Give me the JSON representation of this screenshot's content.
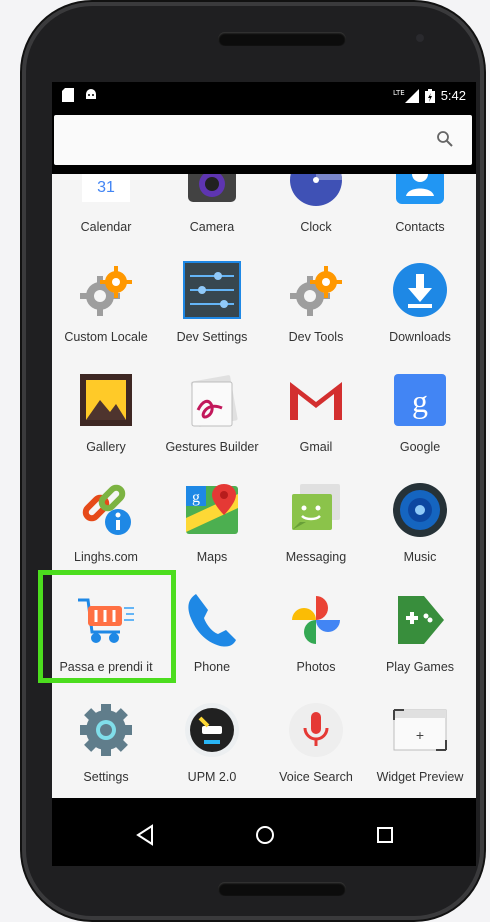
{
  "status": {
    "time": "5:42",
    "network": "LTE"
  },
  "apps": {
    "row1": [
      {
        "label": "Calendar",
        "icon": "calendar-icon"
      },
      {
        "label": "Camera",
        "icon": "camera-icon"
      },
      {
        "label": "Clock",
        "icon": "clock-icon"
      },
      {
        "label": "Contacts",
        "icon": "contacts-icon"
      }
    ],
    "row2": [
      {
        "label": "Custom Locale",
        "icon": "gear-icon"
      },
      {
        "label": "Dev Settings",
        "icon": "sliders-icon"
      },
      {
        "label": "Dev Tools",
        "icon": "gear-icon"
      },
      {
        "label": "Downloads",
        "icon": "download-icon"
      }
    ],
    "row3": [
      {
        "label": "Gallery",
        "icon": "gallery-icon"
      },
      {
        "label": "Gestures Builder",
        "icon": "gestures-icon"
      },
      {
        "label": "Gmail",
        "icon": "gmail-icon"
      },
      {
        "label": "Google",
        "icon": "google-icon"
      }
    ],
    "row4": [
      {
        "label": "Linghs.com",
        "icon": "link-info-icon"
      },
      {
        "label": "Maps",
        "icon": "maps-icon"
      },
      {
        "label": "Messaging",
        "icon": "messaging-icon"
      },
      {
        "label": "Music",
        "icon": "music-icon"
      }
    ],
    "row5": [
      {
        "label": "Passa e prendi it",
        "icon": "shopping-cart-icon"
      },
      {
        "label": "Phone",
        "icon": "phone-icon"
      },
      {
        "label": "Photos",
        "icon": "photos-icon"
      },
      {
        "label": "Play Games",
        "icon": "gamepad-icon"
      }
    ],
    "row6": [
      {
        "label": "Settings",
        "icon": "settings-icon"
      },
      {
        "label": "UPM 2.0",
        "icon": "upm-icon"
      },
      {
        "label": "Voice Search",
        "icon": "microphone-icon"
      },
      {
        "label": "Widget Preview",
        "icon": "widget-preview-icon"
      }
    ]
  },
  "highlight_color": "#4cdd1e"
}
